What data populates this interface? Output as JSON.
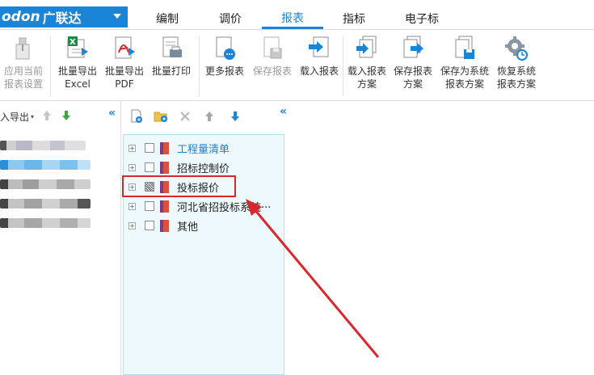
{
  "brand": {
    "logo": "odon",
    "name": "广联达"
  },
  "menu_tabs": [
    {
      "label": "编制",
      "active": false
    },
    {
      "label": "调价",
      "active": false
    },
    {
      "label": "报表",
      "active": true
    },
    {
      "label": "指标",
      "active": false
    },
    {
      "label": "电子标",
      "active": false
    }
  ],
  "ribbon": {
    "apply_current": {
      "line1": "应用当前",
      "line2": "报表设置",
      "disabled": true
    },
    "batch_excel": {
      "line1": "批量导出",
      "line2": "Excel"
    },
    "batch_pdf": {
      "line1": "批量导出",
      "line2": "PDF"
    },
    "batch_print": {
      "line1": "批量打印"
    },
    "more_reports": {
      "line1": "更多报表"
    },
    "save_report": {
      "line1": "保存报表",
      "disabled": true
    },
    "load_report": {
      "line1": "载入报表"
    },
    "load_scheme": {
      "line1": "载入报表",
      "line2": "方案"
    },
    "save_scheme": {
      "line1": "保存报表",
      "line2": "方案"
    },
    "save_system_scheme": {
      "line1": "保存为系统",
      "line2": "报表方案"
    },
    "restore_system_scheme": {
      "line1": "恢复系统",
      "line2": "报表方案"
    }
  },
  "left_panel": {
    "import_export_label": "入导出"
  },
  "tree": {
    "nodes": [
      {
        "label": "工程量清单",
        "selected": true,
        "checkbox": "unchecked"
      },
      {
        "label": "招标控制价",
        "selected": false,
        "checkbox": "unchecked"
      },
      {
        "label": "投标报价",
        "selected": false,
        "checkbox": "partial"
      },
      {
        "label": "河北省招投标系统···",
        "selected": false,
        "checkbox": "unchecked"
      },
      {
        "label": "其他",
        "selected": false,
        "checkbox": "unchecked"
      }
    ]
  },
  "colors": {
    "accent": "#1a84d6",
    "highlight": "#d9272e",
    "arrow": "#d9272e",
    "tree_bg": "#eef9fd"
  }
}
